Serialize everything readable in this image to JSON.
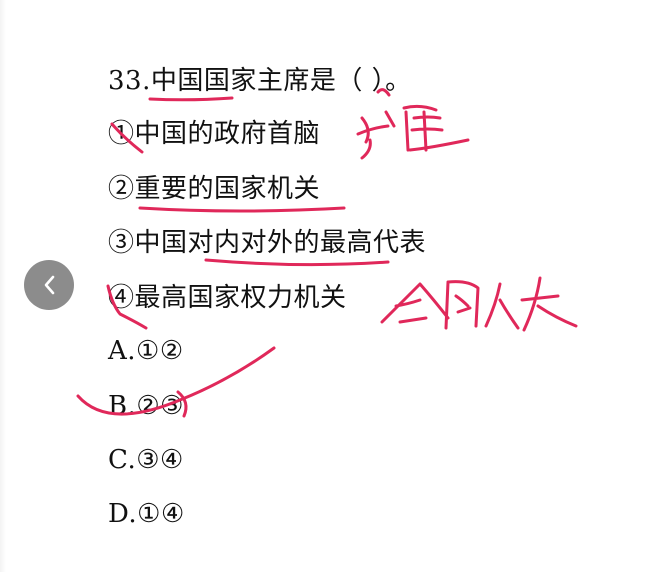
{
  "question": {
    "title": "33.中国国家主席是（  ）。",
    "items": [
      "①中国的政府首脑",
      "②重要的国家机关",
      "③中国对内对外的最高代表",
      "④最高国家权力机关"
    ],
    "options": [
      "A.①②",
      "B.②③",
      "C.③④",
      "D.①④"
    ]
  },
  "annotations": {
    "ink_color": "#e0285a",
    "note_1": "总理",
    "note_2": "全国人大"
  },
  "navigation": {
    "back_icon": "chevron-left-icon"
  }
}
